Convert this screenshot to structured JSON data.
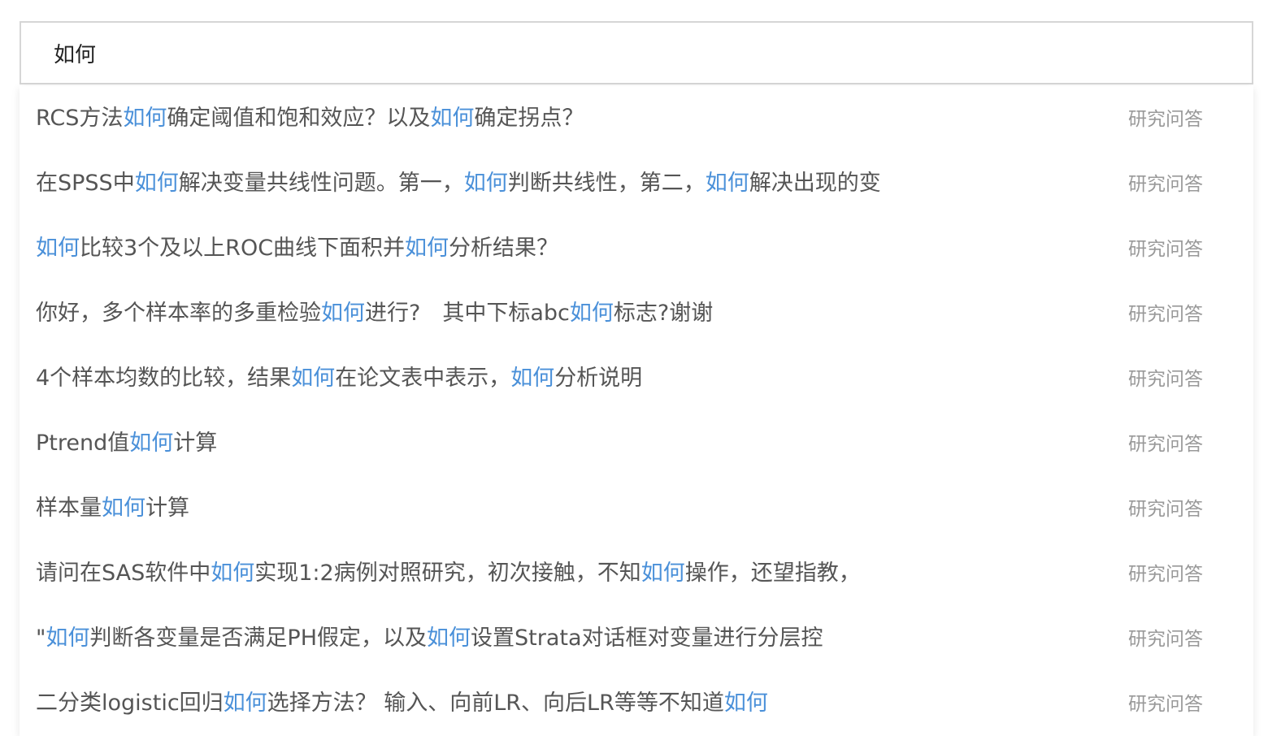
{
  "search": {
    "value": "如何",
    "highlight_color": "#4a90d9"
  },
  "suggestions": [
    {
      "segments": [
        {
          "text": "RCS方法",
          "hl": false
        },
        {
          "text": "如何",
          "hl": true
        },
        {
          "text": "确定阈值和饱和效应？以及",
          "hl": false
        },
        {
          "text": "如何",
          "hl": true
        },
        {
          "text": "确定拐点？",
          "hl": false
        }
      ],
      "category": "研究问答"
    },
    {
      "segments": [
        {
          "text": "在SPSS中",
          "hl": false
        },
        {
          "text": "如何",
          "hl": true
        },
        {
          "text": "解决变量共线性问题。第一，",
          "hl": false
        },
        {
          "text": "如何",
          "hl": true
        },
        {
          "text": "判断共线性，第二，",
          "hl": false
        },
        {
          "text": "如何",
          "hl": true
        },
        {
          "text": "解决出现的变",
          "hl": false
        }
      ],
      "category": "研究问答"
    },
    {
      "segments": [
        {
          "text": "如何",
          "hl": true
        },
        {
          "text": "比较3个及以上ROC曲线下面积并",
          "hl": false
        },
        {
          "text": "如何",
          "hl": true
        },
        {
          "text": "分析结果？",
          "hl": false
        }
      ],
      "category": "研究问答"
    },
    {
      "segments": [
        {
          "text": "你好，多个样本率的多重检验",
          "hl": false
        },
        {
          "text": "如何",
          "hl": true
        },
        {
          "text": "进行?　其中下标abc",
          "hl": false
        },
        {
          "text": "如何",
          "hl": true
        },
        {
          "text": "标志?谢谢",
          "hl": false
        }
      ],
      "category": "研究问答"
    },
    {
      "segments": [
        {
          "text": "4个样本均数的比较，结果",
          "hl": false
        },
        {
          "text": "如何",
          "hl": true
        },
        {
          "text": "在论文表中表示，",
          "hl": false
        },
        {
          "text": "如何",
          "hl": true
        },
        {
          "text": "分析说明",
          "hl": false
        }
      ],
      "category": "研究问答"
    },
    {
      "segments": [
        {
          "text": "Ptrend值",
          "hl": false
        },
        {
          "text": "如何",
          "hl": true
        },
        {
          "text": "计算",
          "hl": false
        }
      ],
      "category": "研究问答"
    },
    {
      "segments": [
        {
          "text": "样本量",
          "hl": false
        },
        {
          "text": "如何",
          "hl": true
        },
        {
          "text": "计算",
          "hl": false
        }
      ],
      "category": "研究问答"
    },
    {
      "segments": [
        {
          "text": "请问在SAS软件中",
          "hl": false
        },
        {
          "text": "如何",
          "hl": true
        },
        {
          "text": "实现1:2病例对照研究，初次接触，不知",
          "hl": false
        },
        {
          "text": "如何",
          "hl": true
        },
        {
          "text": "操作，还望指教，",
          "hl": false
        }
      ],
      "category": "研究问答"
    },
    {
      "segments": [
        {
          "text": "\"",
          "hl": false
        },
        {
          "text": "如何",
          "hl": true
        },
        {
          "text": "判断各变量是否满足PH假定，以及",
          "hl": false
        },
        {
          "text": "如何",
          "hl": true
        },
        {
          "text": "设置Strata对话框对变量进行分层控",
          "hl": false
        }
      ],
      "category": "研究问答"
    },
    {
      "segments": [
        {
          "text": "二分类logistic回归",
          "hl": false
        },
        {
          "text": "如何",
          "hl": true
        },
        {
          "text": "选择方法？ 输入、向前LR、向后LR等等不知道",
          "hl": false
        },
        {
          "text": "如何",
          "hl": true
        }
      ],
      "category": "研究问答"
    }
  ]
}
